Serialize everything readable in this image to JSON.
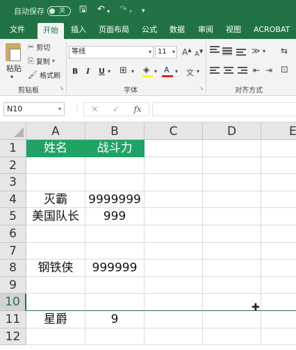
{
  "titlebar": {
    "autosave_label": "自动保存",
    "autosave_state": "关",
    "icons": [
      "save-icon",
      "undo-icon",
      "redo-icon",
      "customize-icon"
    ]
  },
  "tabs": [
    "文件",
    "开始",
    "插入",
    "页面布局",
    "公式",
    "数据",
    "审阅",
    "视图",
    "ACROBAT"
  ],
  "active_tab": "开始",
  "ribbon": {
    "clipboard": {
      "paste": "粘贴",
      "cut": "剪切",
      "copy": "复制",
      "format_painter": "格式刷",
      "group": "剪贴板"
    },
    "font": {
      "name": "等线",
      "size": "11",
      "grow": "A",
      "shrink": "A",
      "bold": "B",
      "italic": "I",
      "underline": "U",
      "fill_color": "A",
      "font_color": "A",
      "group": "字体"
    },
    "alignment": {
      "group": "对齐方式"
    }
  },
  "formula_bar": {
    "name_box": "N10",
    "cancel": "✕",
    "enter": "✓",
    "fx": "fx",
    "value": ""
  },
  "columns": [
    "A",
    "B",
    "C",
    "D",
    "E"
  ],
  "rows": [
    {
      "n": "1",
      "a": "姓名",
      "b": "战斗力"
    },
    {
      "n": "2",
      "a": "",
      "b": ""
    },
    {
      "n": "3",
      "a": "",
      "b": ""
    },
    {
      "n": "4",
      "a": "灭霸",
      "b": "9999999"
    },
    {
      "n": "5",
      "a": "美国队长",
      "b": "999"
    },
    {
      "n": "6",
      "a": "",
      "b": ""
    },
    {
      "n": "7",
      "a": "",
      "b": ""
    },
    {
      "n": "8",
      "a": "钢铁侠",
      "b": "999999"
    },
    {
      "n": "9",
      "a": "",
      "b": ""
    },
    {
      "n": "10",
      "a": "",
      "b": ""
    },
    {
      "n": "11",
      "a": "星爵",
      "b": "9"
    },
    {
      "n": "12",
      "a": "",
      "b": ""
    }
  ],
  "selected_row": "10",
  "colors": {
    "excel_green": "#217346",
    "header_fill": "#21a366"
  }
}
